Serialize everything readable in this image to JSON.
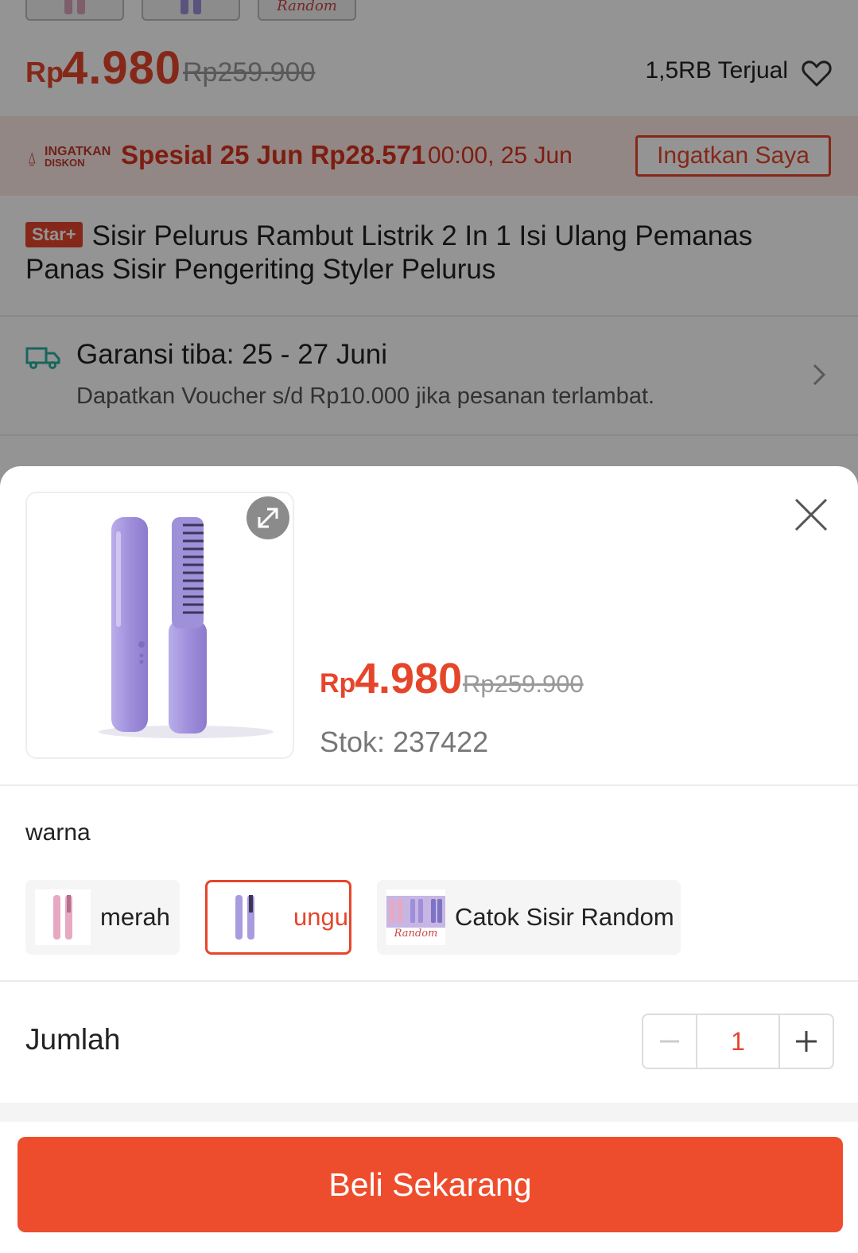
{
  "background_page": {
    "thumbnail_caption": "Random",
    "price": {
      "currency": "Rp",
      "amount": "4.980",
      "original": "Rp259.900"
    },
    "sold": "1,5RB Terjual",
    "flash": {
      "logo_line1": "INGATKAN",
      "logo_line2": "DISKON",
      "special": "Spesial 25 Jun Rp28.571",
      "time": "00:00, 25 Jun",
      "remind_button": "Ingatkan Saya"
    },
    "badge": "Star+",
    "title": "Sisir Pelurus Rambut Listrik 2 In 1 Isi Ulang Pemanas Panas Sisir Pengeriting Styler Pelurus",
    "shipping": {
      "heading": "Garansi tiba: 25 - 27 Juni",
      "subtext": "Dapatkan Voucher s/d Rp10.000 jika pesanan terlambat."
    }
  },
  "sheet": {
    "price": {
      "currency": "Rp",
      "amount": "4.980",
      "original": "Rp259.900"
    },
    "stock": "Stok: 237422",
    "variation_label": "warna",
    "options": [
      {
        "label": "merah",
        "selected": false
      },
      {
        "label": "ungu",
        "selected": true
      },
      {
        "label": "Catok Sisir Random",
        "selected": false,
        "thumb_caption": "Random"
      }
    ],
    "quantity_label": "Jumlah",
    "quantity": "1",
    "buy_button": "Beli Sekarang"
  },
  "colors": {
    "accent": "#ee4d2d",
    "price_red": "#e5462b",
    "product_purple": "#a99be0"
  }
}
